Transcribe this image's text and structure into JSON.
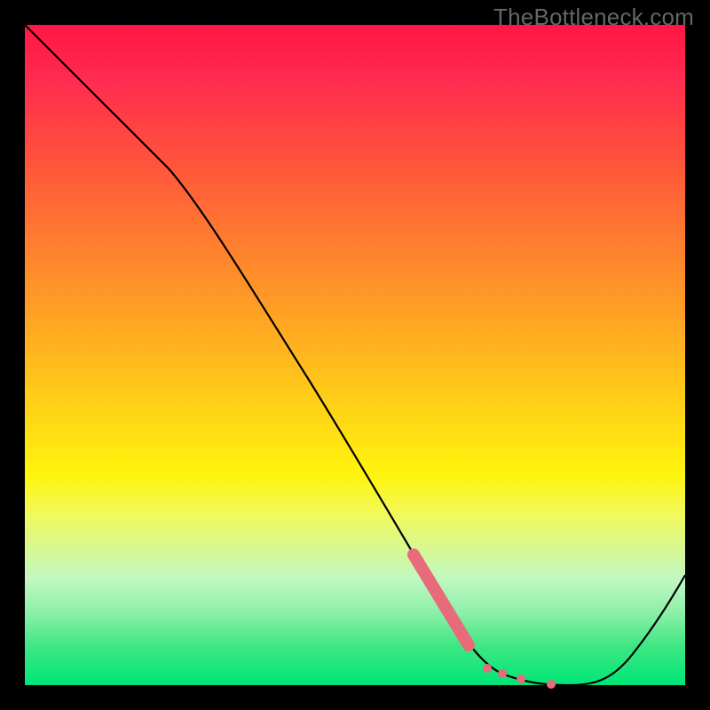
{
  "watermark": "TheBottleneck.com",
  "colors": {
    "background": "#000000",
    "gradient_top": "#ff1744",
    "gradient_bottom": "#00e676",
    "curve": "#000000",
    "tick_marks": "#e76b7a",
    "watermark_text": "#666666"
  },
  "chart_data": {
    "type": "line",
    "title": "",
    "xlabel": "",
    "ylabel": "",
    "xlim": [
      0,
      100
    ],
    "ylim": [
      0,
      100
    ],
    "x": [
      0,
      22,
      66,
      72,
      82,
      100
    ],
    "values": [
      100,
      78,
      7,
      3,
      0,
      17
    ],
    "annotations": [
      {
        "type": "tick_segment",
        "x_start": 59,
        "x_end": 67,
        "style": "thick"
      },
      {
        "type": "tick_cluster",
        "x": [
          71,
          73,
          75,
          79
        ],
        "style": "dots"
      }
    ],
    "background_gradient": {
      "direction": "vertical",
      "stops": [
        {
          "pos": 0.0,
          "color": "#ff1744"
        },
        {
          "pos": 0.5,
          "color": "#ffd216"
        },
        {
          "pos": 0.72,
          "color": "#f2f95a"
        },
        {
          "pos": 1.0,
          "color": "#00e676"
        }
      ]
    }
  }
}
